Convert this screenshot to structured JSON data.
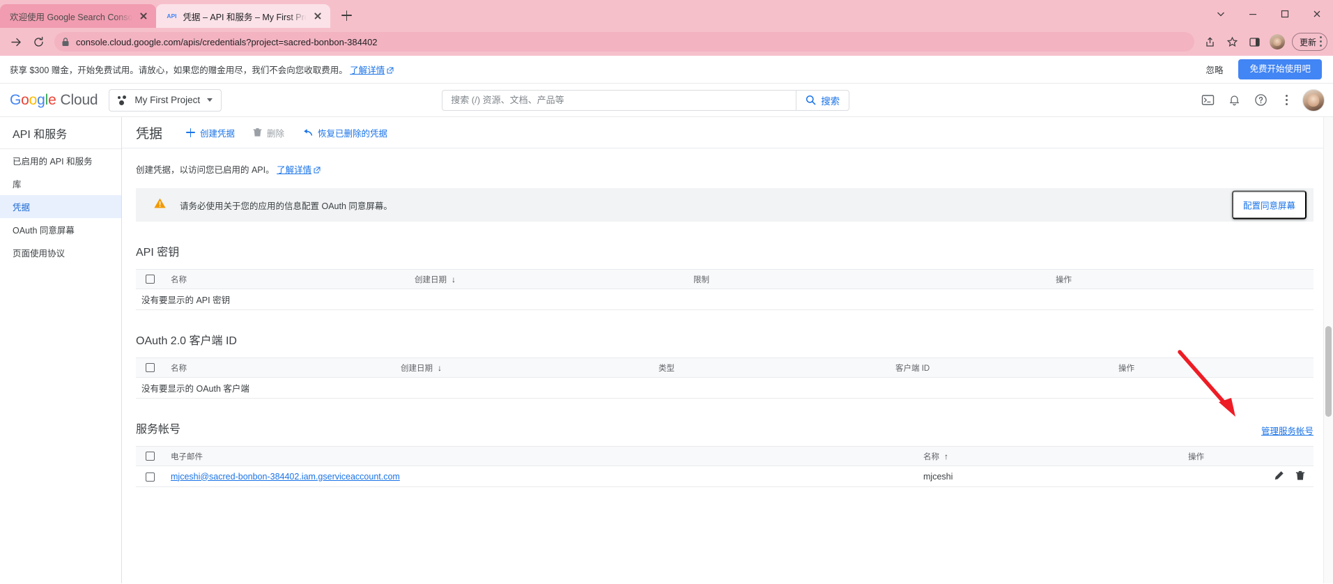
{
  "browser": {
    "tabs": [
      {
        "title": "欢迎使用 Google Search Conso",
        "favicon": "",
        "active": false
      },
      {
        "title": "凭据 – API 和服务 – My First Pro",
        "favicon": "API",
        "active": true
      }
    ],
    "new_tab_label": "+",
    "url": "console.cloud.google.com/apis/credentials?project=sacred-bonbon-384402",
    "update_label": "更新",
    "window_controls": {
      "minimize": "–",
      "maximize": "□",
      "close": "✕",
      "chevron": "⌄"
    }
  },
  "promo": {
    "text": "获享 $300 赠金，开始免费试用。请放心，如果您的赠金用尽，我们不会向您收取费用。",
    "learn_more": "了解详情",
    "dismiss": "忽略",
    "cta": "免费开始使用吧"
  },
  "header": {
    "logo_google": "Google",
    "logo_cloud": "Cloud",
    "project": "My First Project",
    "search_placeholder": "搜索 (/) 资源、文档、产品等",
    "search_value": "",
    "search_button": "搜索"
  },
  "sidebar": {
    "title": "API 和服务",
    "items": [
      {
        "label": "已启用的 API 和服务",
        "active": false
      },
      {
        "label": "库",
        "active": false
      },
      {
        "label": "凭据",
        "active": true
      },
      {
        "label": "OAuth 同意屏幕",
        "active": false
      },
      {
        "label": "页面使用协议",
        "active": false
      }
    ]
  },
  "main": {
    "page_title": "凭据",
    "actions": [
      {
        "label": "创建凭据",
        "icon": "plus-icon",
        "disabled": false
      },
      {
        "label": "删除",
        "icon": "trash-icon",
        "disabled": true
      },
      {
        "label": "恢复已删除的凭据",
        "icon": "undo-icon",
        "disabled": false
      }
    ],
    "intro_text": "创建凭据，以访问您已启用的 API。",
    "intro_link": "了解详情",
    "warning": {
      "text": "请务必使用关于您的应用的信息配置 OAuth 同意屏幕。",
      "button": "配置同意屏幕"
    },
    "sections": [
      {
        "id": "api-keys",
        "title": "API 密钥",
        "columns": [
          "名称",
          "创建日期",
          "限制",
          "操作"
        ],
        "sort_column": "创建日期",
        "sort_dir": "↓",
        "empty_text": "没有要显示的 API 密钥",
        "rows": []
      },
      {
        "id": "oauth-clients",
        "title": "OAuth 2.0 客户端 ID",
        "columns": [
          "名称",
          "创建日期",
          "类型",
          "客户端 ID",
          "操作"
        ],
        "sort_column": "创建日期",
        "sort_dir": "↓",
        "empty_text": "没有要显示的 OAuth 客户端",
        "rows": []
      },
      {
        "id": "service-accounts",
        "title": "服务帐号",
        "manage_link": "管理服务帐号",
        "columns": [
          "电子邮件",
          "名称",
          "操作"
        ],
        "sort_column": "名称",
        "sort_dir": "↑",
        "rows": [
          {
            "email": "mjceshi@sacred-bonbon-384402.iam.gserviceaccount.com",
            "name": "mjceshi"
          }
        ]
      }
    ]
  },
  "colors": {
    "accent_blue": "#1a73e8",
    "cta_blue": "#4285f4",
    "warning_orange": "#f29900",
    "active_item_bg": "#e8f0fe",
    "annotation_red": "#ee1c25",
    "chrome_pink": "#f6c0cb"
  }
}
